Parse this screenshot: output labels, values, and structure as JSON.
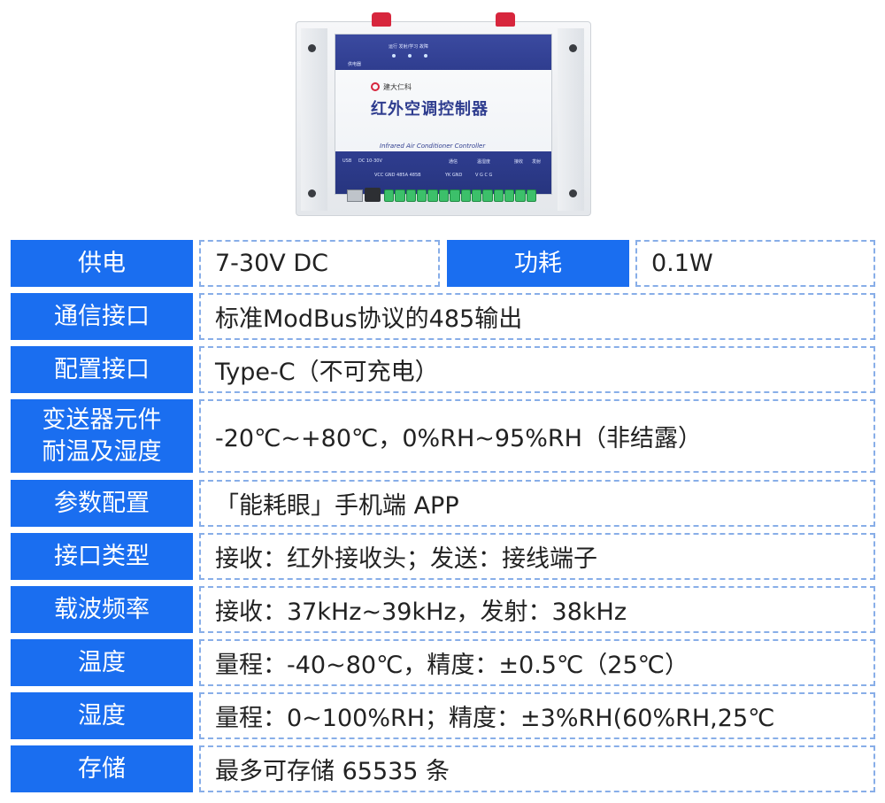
{
  "device_image": {
    "brand": "建大仁科",
    "title": "红外空调控制器",
    "subtitle": "Infrared Air Conditioner Controller",
    "top_labels": "运行 发射/学习 故障",
    "power_label": "供电器",
    "bottom_labels": [
      "USB",
      "DC 10-30V",
      "VCC GND 485A 485B",
      "通信",
      "YK GND",
      "温湿度",
      "V G C G",
      "接收",
      "发射"
    ]
  },
  "specs": {
    "row1": {
      "label_a": "供电",
      "value_a": "7-30V DC",
      "label_b": "功耗",
      "value_b": "0.1W"
    },
    "rows": [
      {
        "label": "通信接口",
        "value": "标准ModBus协议的485输出"
      },
      {
        "label": "配置接口",
        "value": "Type-C（不可充电）"
      },
      {
        "label_line1": "变送器元件",
        "label_line2": "耐温及湿度",
        "value": "-20℃~+80℃，0%RH~95%RH（非结露）"
      },
      {
        "label": "参数配置",
        "value": "「能耗眼」手机端 APP"
      },
      {
        "label": "接口类型",
        "value": "接收：红外接收头；发送：接线端子"
      },
      {
        "label": "载波频率",
        "value": "接收：37kHz~39kHz，发射：38kHz"
      },
      {
        "label": "温度",
        "value": "量程：-40~80℃，精度：±0.5℃（25℃）"
      },
      {
        "label": "湿度",
        "value": "量程：0~100%RH；精度：±3%RH(60%RH,25℃"
      },
      {
        "label": "存储",
        "value": "最多可存储 65535 条"
      }
    ]
  },
  "colors": {
    "label_bg": "#1a6ef0",
    "border": "#88aee8",
    "device_blue": "#2f3d8f"
  }
}
